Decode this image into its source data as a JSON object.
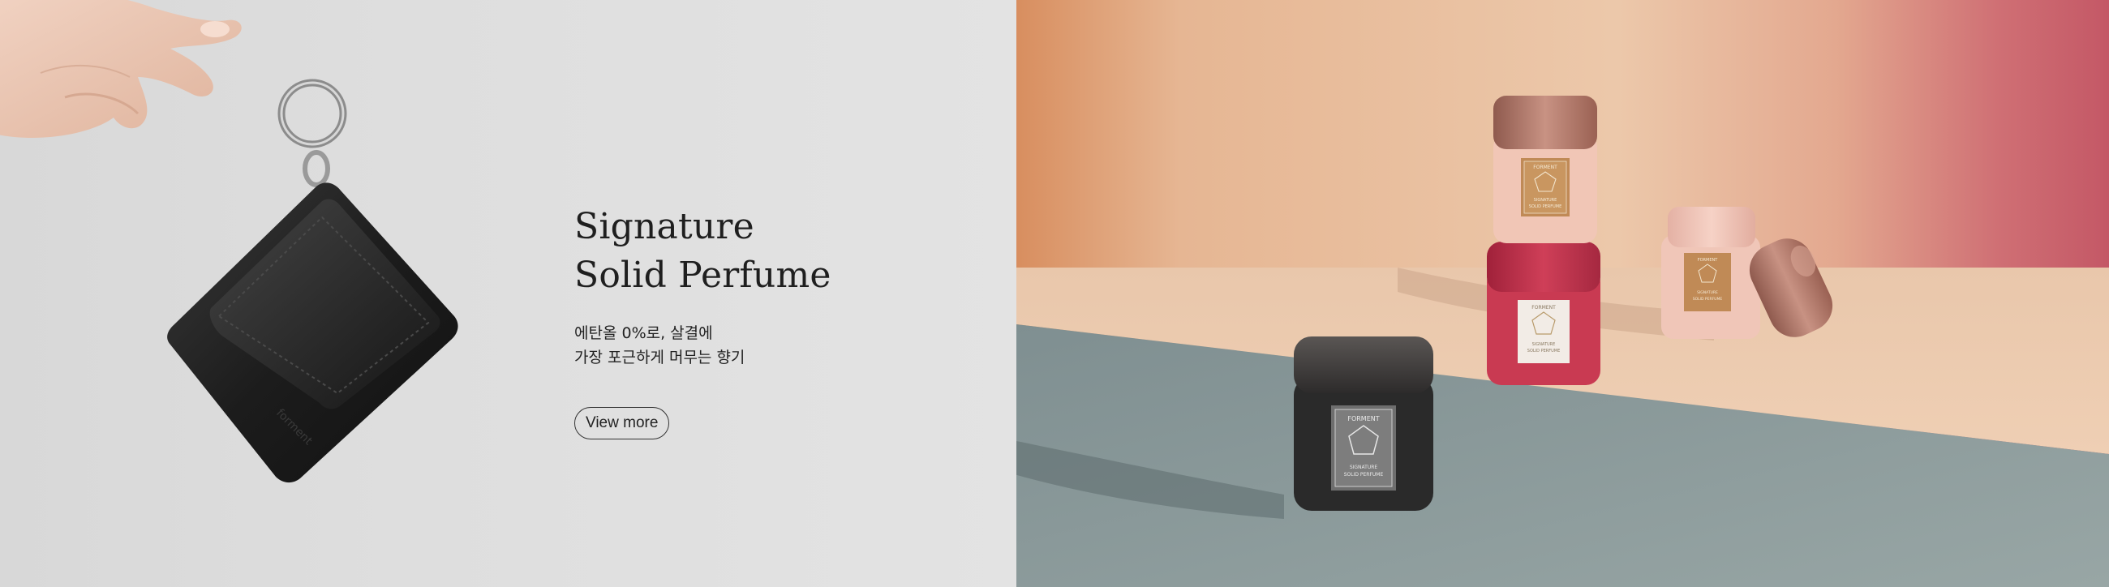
{
  "banner": {
    "title_line1": "Signature",
    "title_line2": "Solid Perfume",
    "desc_line1": "에탄올 0%로, 살결에",
    "desc_line2": "가장 포근하게 머무는 향기",
    "cta_label": "View more"
  },
  "product": {
    "brand_label": "FORMENT",
    "label_line1": "SIGNATURE",
    "label_line2": "SOLID PERFUME"
  },
  "colors": {
    "left_bg": "#dedede",
    "wall_peach": "#e9c2a2",
    "wall_pink": "#c9606a",
    "floor_gray": "#8a9a9a",
    "case_black": "#2f2f2f",
    "case_red": "#c73c53",
    "case_pink": "#f1c3b5",
    "cap_rose_gold": "#b97a6a"
  }
}
